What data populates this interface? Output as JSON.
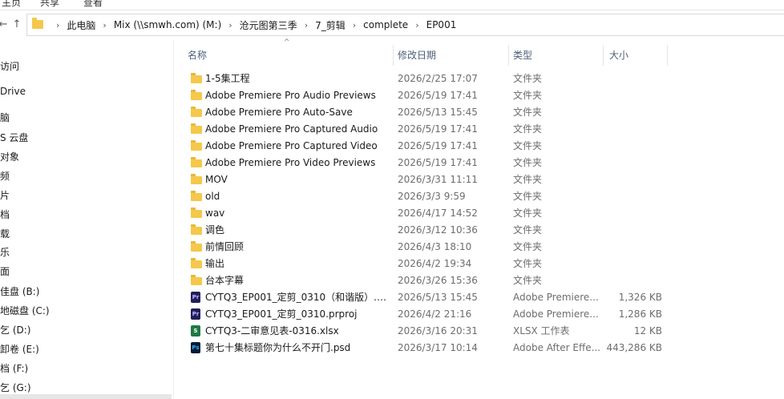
{
  "ribbon": {
    "items": [
      "主页",
      "共享",
      "查看"
    ]
  },
  "nav": {
    "back_arrow": "←",
    "forward_arrow": "↑"
  },
  "breadcrumb": [
    "此电脑",
    "Mix (\\\\smwh.com) (M:)",
    "沧元图第三季",
    "7_剪辑",
    "complete",
    "EP001"
  ],
  "sidebar": {
    "items": [
      {
        "label": "访问",
        "icon": "quick-access-icon"
      },
      {
        "label": "Drive",
        "icon": "onedrive-icon"
      },
      {
        "label": "脑",
        "icon": "this-pc-icon"
      },
      {
        "label": "S 云盘",
        "icon": "cloud-drive-icon"
      },
      {
        "label": "对象",
        "icon": "3d-objects-icon"
      },
      {
        "label": "频",
        "icon": "videos-icon"
      },
      {
        "label": "片",
        "icon": "pictures-icon"
      },
      {
        "label": "档",
        "icon": "documents-icon"
      },
      {
        "label": "载",
        "icon": "downloads-icon"
      },
      {
        "label": "乐",
        "icon": "music-icon"
      },
      {
        "label": "面",
        "icon": "desktop-icon"
      },
      {
        "label": "佳盘 (B:)",
        "icon": "drive-icon"
      },
      {
        "label": "地磁盘 (C:)",
        "icon": "drive-icon"
      },
      {
        "label": "乞 (D:)",
        "icon": "drive-icon"
      },
      {
        "label": "卸卷 (E:)",
        "icon": "drive-icon"
      },
      {
        "label": "档 (F:)",
        "icon": "drive-icon"
      },
      {
        "label": "乞 (G:)",
        "icon": "drive-icon"
      }
    ]
  },
  "columns": {
    "name": "名称",
    "date": "修改日期",
    "type": "类型",
    "size": "大小",
    "sort_indicator": "^"
  },
  "files": [
    {
      "name": "1-5集工程",
      "date": "2026/2/25 17:07",
      "type": "文件夹",
      "size": "",
      "icon": "folder"
    },
    {
      "name": "Adobe Premiere Pro Audio Previews",
      "date": "2026/5/19 17:41",
      "type": "文件夹",
      "size": "",
      "icon": "folder"
    },
    {
      "name": "Adobe Premiere Pro Auto-Save",
      "date": "2026/5/13 15:45",
      "type": "文件夹",
      "size": "",
      "icon": "folder"
    },
    {
      "name": "Adobe Premiere Pro Captured Audio",
      "date": "2026/5/19 17:41",
      "type": "文件夹",
      "size": "",
      "icon": "folder"
    },
    {
      "name": "Adobe Premiere Pro Captured Video",
      "date": "2026/5/19 17:41",
      "type": "文件夹",
      "size": "",
      "icon": "folder"
    },
    {
      "name": "Adobe Premiere Pro Video Previews",
      "date": "2026/5/19 17:41",
      "type": "文件夹",
      "size": "",
      "icon": "folder"
    },
    {
      "name": "MOV",
      "date": "2026/3/31 11:11",
      "type": "文件夹",
      "size": "",
      "icon": "folder"
    },
    {
      "name": "old",
      "date": "2026/3/3 9:59",
      "type": "文件夹",
      "size": "",
      "icon": "folder"
    },
    {
      "name": "wav",
      "date": "2026/4/17 14:52",
      "type": "文件夹",
      "size": "",
      "icon": "folder"
    },
    {
      "name": "调色",
      "date": "2026/3/12 10:36",
      "type": "文件夹",
      "size": "",
      "icon": "folder"
    },
    {
      "name": "前情回顾",
      "date": "2026/4/3 18:10",
      "type": "文件夹",
      "size": "",
      "icon": "folder"
    },
    {
      "name": "输出",
      "date": "2026/4/2 19:34",
      "type": "文件夹",
      "size": "",
      "icon": "folder"
    },
    {
      "name": "台本字幕",
      "date": "2026/3/26 15:36",
      "type": "文件夹",
      "size": "",
      "icon": "folder"
    },
    {
      "name": "CYTQ3_EP001_定剪_0310（和谐版）.pr...",
      "date": "2026/5/13 15:45",
      "type": "Adobe Premiere...",
      "size": "1,326 KB",
      "icon": "pr",
      "icon_text": "Pr"
    },
    {
      "name": "CYTQ3_EP001_定剪_0310.prproj",
      "date": "2026/4/2 21:16",
      "type": "Adobe Premiere...",
      "size": "1,286 KB",
      "icon": "pr",
      "icon_text": "Pr"
    },
    {
      "name": "CYTQ3-二审意见表-0316.xlsx",
      "date": "2026/3/16 20:31",
      "type": "XLSX 工作表",
      "size": "12 KB",
      "icon": "xl",
      "icon_text": "S"
    },
    {
      "name": "第七十集标题你为什么不开门.psd",
      "date": "2026/3/17 10:14",
      "type": "Adobe After Effe...",
      "size": "443,286 KB",
      "icon": "ps",
      "icon_text": "Ps"
    }
  ]
}
